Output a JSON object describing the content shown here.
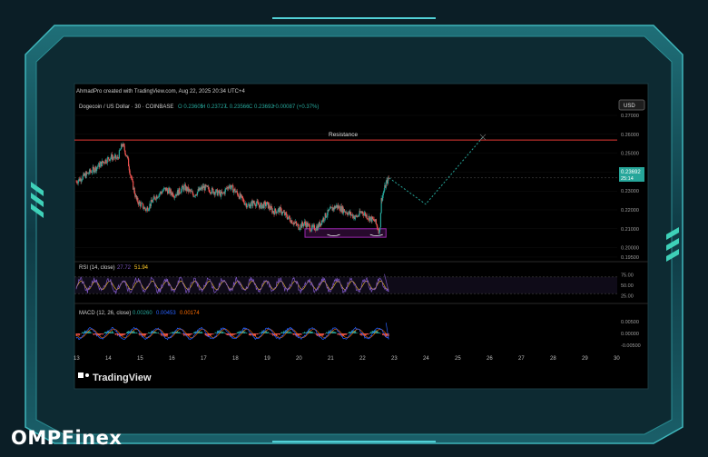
{
  "brand": "OMPFinex",
  "header_credit": "AhmadPro created with TradingView.com, Aug 22, 2025 20:34 UTC+4",
  "currency": "USD",
  "footer_logo": "TradingView",
  "colors": {
    "up": "#26a69a",
    "down": "#ef5350",
    "resistance": "#e53935",
    "support_box": "#9c27b0",
    "projection": "#26a69a",
    "rsi": "#7e57c2",
    "macd": "#2962ff",
    "signal": "#ff6d00"
  },
  "chart_data": [
    {
      "type": "candlestick",
      "title": "Dogecoin / US Dollar · 30 · COINBASE",
      "ohlc": {
        "O": "O 0.23605",
        "H": "H 0.23727",
        "L": "L 0.23566",
        "C": "C 0.23692",
        "change": "+0.00087 (+0.37%)"
      },
      "x_ticks": [
        "13",
        "14",
        "15",
        "16",
        "17",
        "18",
        "19",
        "20",
        "21",
        "22",
        "23",
        "24",
        "25",
        "26",
        "27",
        "28",
        "29",
        "30"
      ],
      "y_ticks": [
        "0.27000",
        "0.26000",
        "0.25000",
        "0.24000",
        "0.23000",
        "0.22000",
        "0.21000",
        "0.20000",
        "0.19500"
      ],
      "ylim": [
        0.1945,
        0.2705
      ],
      "last_price": "0.23692",
      "countdown": "25:14",
      "annotation": "Resistance",
      "resistance_level": 0.257,
      "close_path_days": [
        [
          13.0,
          0.235
        ],
        [
          13.3,
          0.2385
        ],
        [
          13.6,
          0.242
        ],
        [
          13.9,
          0.246
        ],
        [
          14.1,
          0.248
        ],
        [
          14.3,
          0.247
        ],
        [
          14.45,
          0.255
        ],
        [
          14.6,
          0.248
        ],
        [
          14.75,
          0.235
        ],
        [
          14.9,
          0.225
        ],
        [
          15.2,
          0.22
        ],
        [
          15.5,
          0.227
        ],
        [
          15.8,
          0.231
        ],
        [
          16.1,
          0.228
        ],
        [
          16.4,
          0.232
        ],
        [
          16.7,
          0.228
        ],
        [
          17.0,
          0.232
        ],
        [
          17.3,
          0.23
        ],
        [
          17.6,
          0.228
        ],
        [
          17.8,
          0.233
        ],
        [
          18.0,
          0.23
        ],
        [
          18.2,
          0.226
        ],
        [
          18.4,
          0.222
        ],
        [
          18.6,
          0.224
        ],
        [
          18.8,
          0.222
        ],
        [
          19.0,
          0.223
        ],
        [
          19.2,
          0.219
        ],
        [
          19.4,
          0.22
        ],
        [
          19.6,
          0.217
        ],
        [
          19.8,
          0.214
        ],
        [
          20.0,
          0.211
        ],
        [
          20.2,
          0.213
        ],
        [
          20.4,
          0.21
        ],
        [
          20.6,
          0.211
        ],
        [
          20.8,
          0.216
        ],
        [
          21.0,
          0.22
        ],
        [
          21.2,
          0.222
        ],
        [
          21.4,
          0.22
        ],
        [
          21.6,
          0.218
        ],
        [
          21.8,
          0.216
        ],
        [
          22.0,
          0.219
        ],
        [
          22.2,
          0.216
        ],
        [
          22.4,
          0.214
        ],
        [
          22.55,
          0.208
        ],
        [
          22.6,
          0.225
        ],
        [
          22.75,
          0.234
        ],
        [
          22.85,
          0.2369
        ]
      ],
      "support_zone": {
        "x_start": 20.2,
        "x_end": 22.75,
        "y_low": 0.2055,
        "y_high": 0.21
      },
      "projection": [
        [
          22.85,
          0.2369
        ],
        [
          24.0,
          0.223
        ],
        [
          25.8,
          0.2585
        ]
      ]
    },
    {
      "type": "line",
      "title": "RSI (14, close)",
      "values_text": [
        "27.72",
        "51.94"
      ],
      "y_ticks": [
        "75.00",
        "50.00",
        "25.00"
      ],
      "bands": [
        70,
        30
      ],
      "ylim": [
        15,
        85
      ]
    },
    {
      "type": "histogram",
      "title": "MACD (12, 26, close)",
      "values_text": [
        "0.00260",
        "0.00453",
        "0.00174"
      ],
      "y_ticks": [
        "0.00500",
        "0.00000",
        "-0.00500"
      ],
      "ylim": [
        -0.0065,
        0.0065
      ]
    }
  ]
}
